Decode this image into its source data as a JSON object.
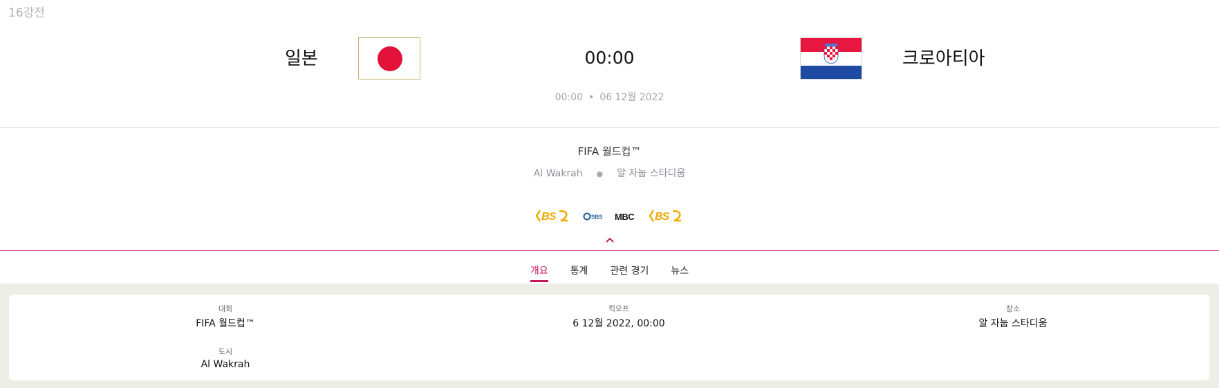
{
  "round": "16강전",
  "match": {
    "home_team": "일본",
    "away_team": "크로아티아",
    "score": "00:00",
    "kickoff_time": "00:00",
    "kickoff_date": "06 12월 2022",
    "separator": "•"
  },
  "details": {
    "competition": "FIFA 월드컵™",
    "city": "Al Wakrah",
    "separator": "●",
    "stadium": "알 자눕 스타디움"
  },
  "broadcasters": [
    "KBS2",
    "SBS",
    "MBC",
    "KBS2"
  ],
  "tabs": [
    "개요",
    "통계",
    "관련 경기",
    "뉴스"
  ],
  "active_tab": "개요",
  "info": {
    "competition_label": "대회",
    "competition_value": "FIFA 월드컵™",
    "kickoff_label": "킥오프",
    "kickoff_value": "6 12월 2022, 00:00",
    "venue_label": "장소",
    "venue_value": "알 자눕 스타디움",
    "city_label": "도시",
    "city_value": "Al Wakrah"
  },
  "colors": {
    "accent": "#c2185b",
    "japan_red": "#e2123a",
    "croatia_red": "#e8173f",
    "croatia_blue": "#1f4aa1",
    "kbs_gold": "#f2a900",
    "panel_bg": "#efeee6"
  }
}
